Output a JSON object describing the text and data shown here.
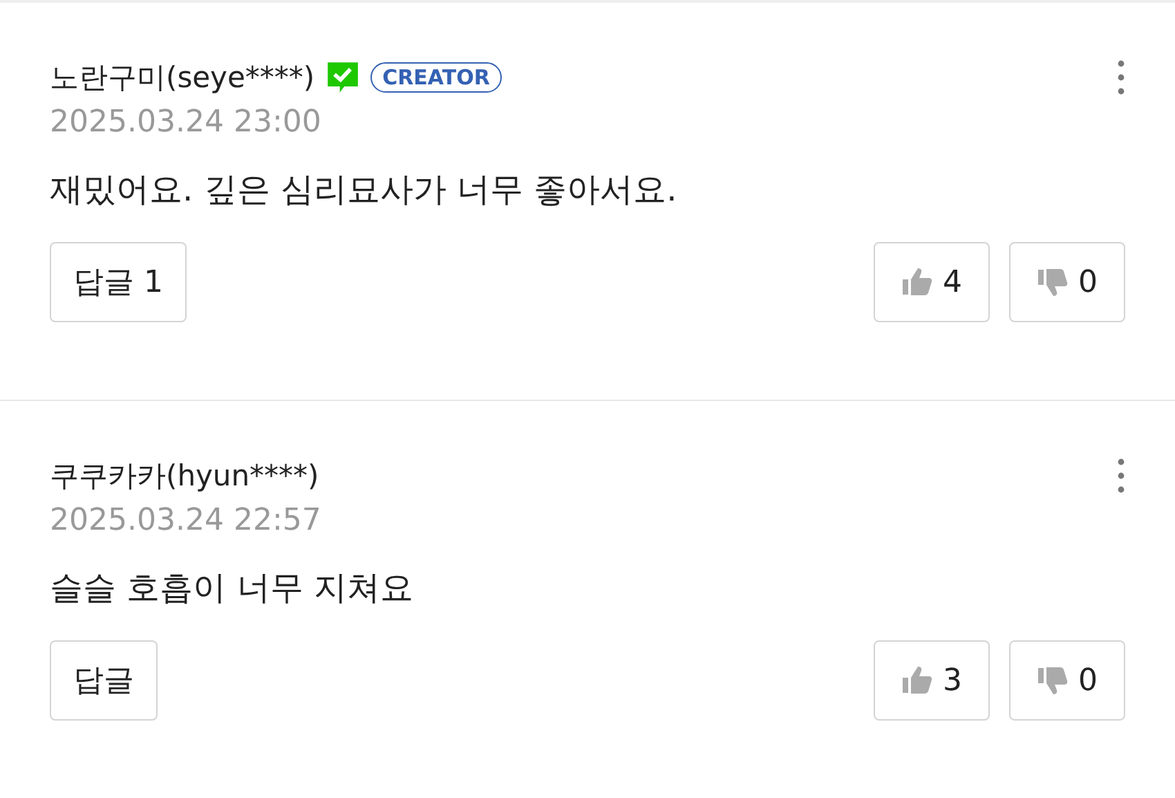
{
  "comments": [
    {
      "author": "노란구미(seye****)",
      "verified": true,
      "badge": "CREATOR",
      "date": "2025.03.24 23:00",
      "text": "재밌어요. 깊은 심리묘사가 너무 좋아서요.",
      "reply": "답글 1",
      "likes": "4",
      "dislikes": "0"
    },
    {
      "author": "쿠쿠카카(hyun****)",
      "verified": false,
      "date": "2025.03.24 22:57",
      "text": "슬슬 호흡이 너무 지쳐요",
      "reply": "답글",
      "likes": "3",
      "dislikes": "0"
    }
  ]
}
